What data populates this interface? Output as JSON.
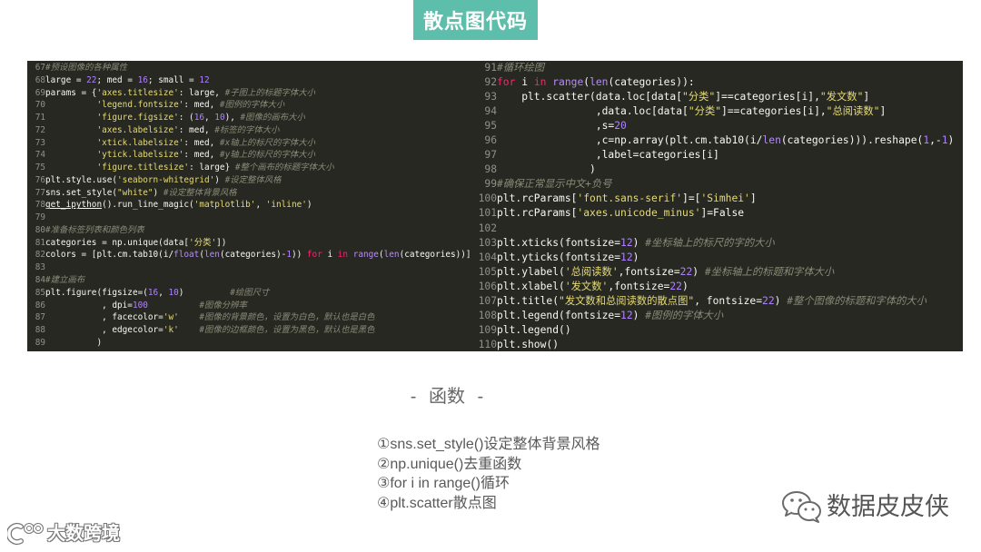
{
  "header": {
    "title": "散点图代码"
  },
  "colors": {
    "accent": "#5dbfab",
    "code_background": "#272822",
    "text": "#595959"
  },
  "code_left": {
    "lines": [
      {
        "n": "67",
        "text": "#预设图像的各种属性"
      },
      {
        "n": "68",
        "text": "large = 22; med = 16; small = 12"
      },
      {
        "n": "69",
        "text": "params = {'axes.titlesize': large, #子图上的标题字体大小"
      },
      {
        "n": "70",
        "text": "          'legend.fontsize': med, #图例的字体大小"
      },
      {
        "n": "71",
        "text": "          'figure.figsize': (16, 10), #图像的画布大小"
      },
      {
        "n": "72",
        "text": "          'axes.labelsize': med, #标签的字体大小"
      },
      {
        "n": "73",
        "text": "          'xtick.labelsize': med, #x轴上的标尺的字体大小"
      },
      {
        "n": "74",
        "text": "          'ytick.labelsize': med, #y轴上的标尺的字体大小"
      },
      {
        "n": "75",
        "text": "          'figure.titlesize': large} #整个画布的标题字体大小"
      },
      {
        "n": "76",
        "text": "plt.style.use('seaborn-whitegrid') #设定整体风格"
      },
      {
        "n": "77",
        "text": "sns.set_style(\"white\") #设定整体背景风格"
      },
      {
        "n": "78",
        "text": "get_ipython().run_line_magic('matplotlib', 'inline')"
      },
      {
        "n": "79",
        "text": ""
      },
      {
        "n": "80",
        "text": "#准备标签列表和颜色列表"
      },
      {
        "n": "81",
        "text": "categories = np.unique(data['分类'])"
      },
      {
        "n": "82",
        "text": "colors = [plt.cm.tab10(i/float(len(categories)-1)) for i in range(len(categories))]"
      },
      {
        "n": "83",
        "text": ""
      },
      {
        "n": "84",
        "text": "#建立画布"
      },
      {
        "n": "85",
        "text": "plt.figure(figsize=(16, 10)         #绘图尺寸"
      },
      {
        "n": "86",
        "text": "           , dpi=100          #图像分辨率"
      },
      {
        "n": "87",
        "text": "           , facecolor='w'    #图像的背景颜色，设置为白色，默认也是白色"
      },
      {
        "n": "88",
        "text": "           , edgecolor='k'    #图像的边框颜色，设置为黑色，默认也是黑色"
      },
      {
        "n": "89",
        "text": "          )"
      }
    ]
  },
  "code_right": {
    "lines": [
      {
        "n": "91",
        "text": "#循环绘图"
      },
      {
        "n": "92",
        "text": "for i in range(len(categories)):"
      },
      {
        "n": "93",
        "text": "    plt.scatter(data.loc[data[\"分类\"]==categories[i],\"发文数\"]"
      },
      {
        "n": "94",
        "text": "                ,data.loc[data[\"分类\"]==categories[i],\"总阅读数\"]"
      },
      {
        "n": "95",
        "text": "                ,s=20"
      },
      {
        "n": "96",
        "text": "                ,c=np.array(plt.cm.tab10(i/len(categories))).reshape(1,-1)"
      },
      {
        "n": "97",
        "text": "                ,label=categories[i]"
      },
      {
        "n": "98",
        "text": "               )"
      },
      {
        "n": "99",
        "text": "#确保正常显示中文+负号"
      },
      {
        "n": "100",
        "text": "plt.rcParams['font.sans-serif']=['Simhei']"
      },
      {
        "n": "101",
        "text": "plt.rcParams['axes.unicode_minus']=False"
      },
      {
        "n": "102",
        "text": ""
      },
      {
        "n": "103",
        "text": "plt.xticks(fontsize=12) #坐标轴上的标尺的字的大小"
      },
      {
        "n": "104",
        "text": "plt.yticks(fontsize=12)"
      },
      {
        "n": "105",
        "text": "plt.ylabel('总阅读数',fontsize=22) #坐标轴上的标题和字体大小"
      },
      {
        "n": "106",
        "text": "plt.xlabel('发文数',fontsize=22)"
      },
      {
        "n": "107",
        "text": "plt.title(\"发文数和总阅读数的散点图\", fontsize=22) #整个图像的标题和字体的大小"
      },
      {
        "n": "108",
        "text": "plt.legend(fontsize=12) #图例的字体大小"
      },
      {
        "n": "109",
        "text": "plt.legend()"
      },
      {
        "n": "110",
        "text": "plt.show()"
      }
    ]
  },
  "functions": {
    "heading": "- 函数 -",
    "items": [
      "①sns.set_style()设定整体背景风格",
      "②np.unique()去重函数",
      "③for i in range()循环",
      "④plt.scatter散点图"
    ]
  },
  "brand": {
    "name": "数据皮皮侠",
    "icon": "wechat-icon"
  },
  "watermark": {
    "text": "大数跨境",
    "icon": "watermark-logo-icon"
  }
}
